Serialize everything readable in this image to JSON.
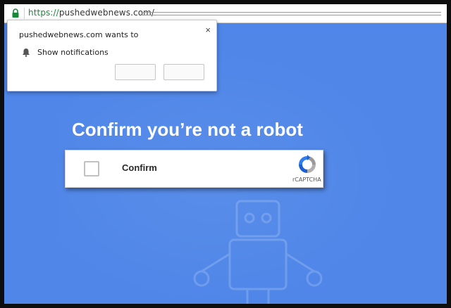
{
  "browser": {
    "url_scheme": "https://",
    "url_host": "pushedwebnews.com/"
  },
  "notification_prompt": {
    "title": "pushedwebnews.com wants to",
    "permission": "Show notifications",
    "close_label": "×",
    "block_label": "",
    "allow_label": ""
  },
  "page": {
    "headline": "Confirm you’re not a robot",
    "captcha": {
      "label": "Confirm",
      "brand": "rCAPTCHA"
    }
  },
  "colors": {
    "background": "#4f86e8",
    "url_scheme": "#1a8a3a",
    "logo_blue": "#1c5fd0",
    "logo_gray": "#9a9a9a"
  },
  "icons": [
    "lock-icon",
    "bell-icon",
    "recaptcha-logo-icon",
    "robot-illustration"
  ]
}
